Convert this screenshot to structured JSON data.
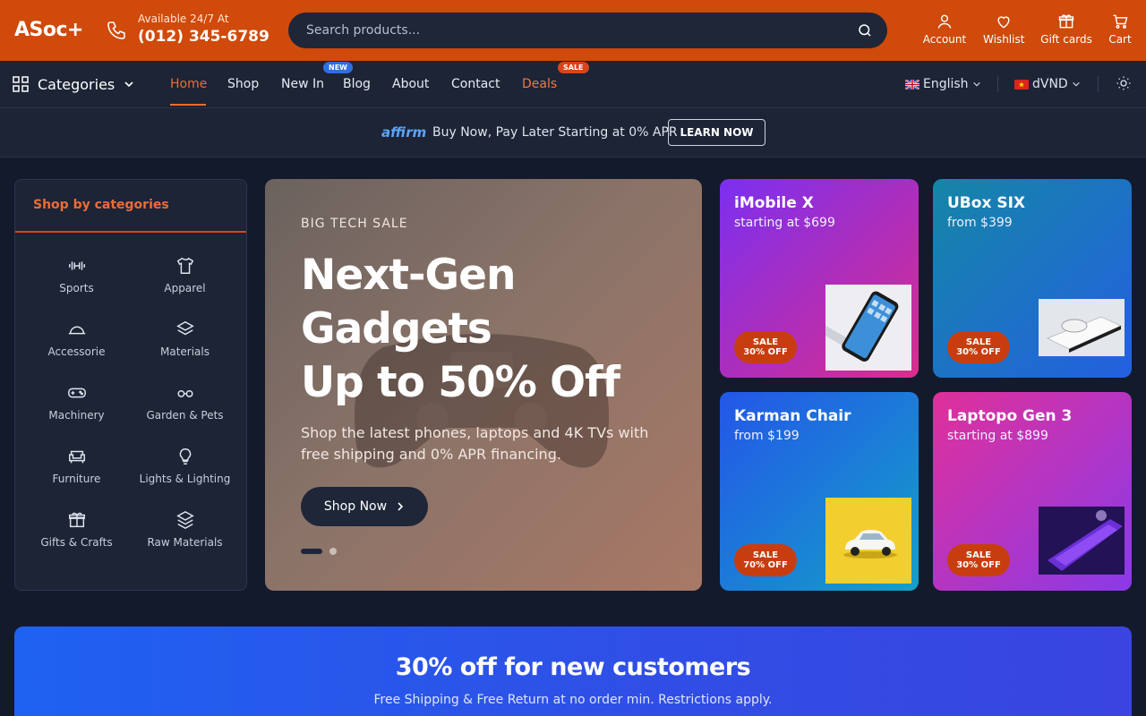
{
  "header": {
    "logo": "ASoc+",
    "phone_label": "Available 24/7 At",
    "phone_number": "(012) 345-6789",
    "search_placeholder": "Search products...",
    "actions": [
      {
        "label": "Account",
        "icon": "user-icon"
      },
      {
        "label": "Wishlist",
        "icon": "heart-icon"
      },
      {
        "label": "Gift cards",
        "icon": "gift-icon"
      },
      {
        "label": "Cart",
        "icon": "cart-icon"
      }
    ]
  },
  "nav": {
    "categories_label": "Categories",
    "items": [
      "Home",
      "Shop",
      "New In",
      "Blog",
      "About",
      "Contact",
      "Deals"
    ],
    "badges": {
      "new": "NEW",
      "sale": "SALE"
    },
    "language": "English",
    "currency": "dVND"
  },
  "affirm": {
    "logo": "affirm",
    "text": "Buy Now, Pay Later Starting at 0% APR",
    "button": "LEARN NOW"
  },
  "categories": {
    "title": "Shop by categories",
    "items": [
      {
        "label": "Sports",
        "icon": "dumbbell-icon"
      },
      {
        "label": "Apparel",
        "icon": "shirt-icon"
      },
      {
        "label": "Accessorie",
        "icon": "cap-icon"
      },
      {
        "label": "Materials",
        "icon": "layers-icon"
      },
      {
        "label": "Machinery",
        "icon": "gamepad-icon"
      },
      {
        "label": "Garden & Pets",
        "icon": "glasses-icon"
      },
      {
        "label": "Furniture",
        "icon": "armchair-icon"
      },
      {
        "label": "Lights & Lighting",
        "icon": "bulb-icon"
      },
      {
        "label": "Gifts & Crafts",
        "icon": "gift-icon"
      },
      {
        "label": "Raw Materials",
        "icon": "stack-icon"
      }
    ]
  },
  "hero": {
    "kicker": "BIG TECH SALE",
    "title_lines": [
      "Next-Gen",
      "Gadgets",
      "Up to 50% Off"
    ],
    "description": "Shop the latest phones, laptops and 4K TVs with free shipping and 0% APR financing.",
    "button": "Shop Now"
  },
  "promos": [
    {
      "title": "iMobile X",
      "subtitle": "starting at $699",
      "sale_line1": "SALE",
      "sale_line2": "30% OFF",
      "gradient": [
        "#7b2ff0",
        "#d92e8c"
      ]
    },
    {
      "title": "UBox SIX",
      "subtitle": "from $399",
      "sale_line1": "SALE",
      "sale_line2": "30% OFF",
      "gradient": [
        "#1586a6",
        "#2360e0"
      ]
    },
    {
      "title": "Karman Chair",
      "subtitle": "from $199",
      "sale_line1": "SALE",
      "sale_line2": "70% OFF",
      "gradient": [
        "#2456e8",
        "#14a0c8"
      ]
    },
    {
      "title": "Laptopo Gen 3",
      "subtitle": "starting at $899",
      "sale_line1": "SALE",
      "sale_line2": "30% OFF",
      "gradient": [
        "#e0309a",
        "#8a3ae8"
      ]
    }
  ],
  "banner": {
    "title": "30% off for new customers",
    "subtitle": "Free Shipping & Free Return at no order min. Restrictions apply."
  },
  "colors": {
    "brand_orange": "#cf4a0b",
    "accent": "#f06b34",
    "navy": "#1c2436",
    "page_bg": "#131a2c"
  }
}
